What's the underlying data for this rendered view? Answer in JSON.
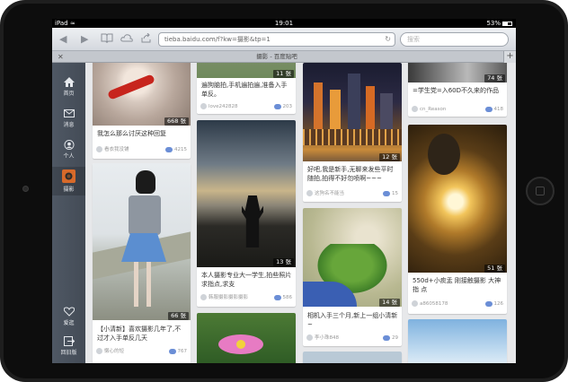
{
  "status": {
    "carrier": "iPad",
    "time": "19:01",
    "battery": "53%"
  },
  "browser": {
    "url": "tieba.baidu.com/f?kw=摄影&tp=1",
    "search_placeholder": "搜索",
    "tab_title": "摄影 - 百度贴吧",
    "tab_add": "+",
    "tab_close": "✕"
  },
  "sidebar": {
    "items": [
      {
        "label": "首页",
        "icon": "home-icon"
      },
      {
        "label": "消息",
        "icon": "mail-icon"
      },
      {
        "label": "个人",
        "icon": "person-icon"
      },
      {
        "label": "摄影",
        "icon": "forum-avatar"
      },
      {
        "label": "爱逛",
        "icon": "heart-icon"
      },
      {
        "label": "回旧版",
        "icon": "exit-icon"
      }
    ]
  },
  "posts": [
    {
      "count": "668 张",
      "caption": "我怎么那么讨厌这种回复",
      "user": "看衣我没铺",
      "replies": "4215"
    },
    {
      "count": "66 张",
      "caption": "【小清新】喜欢摄影几年了,不过才入手单反几天",
      "user": "懒心的短",
      "replies": "767"
    },
    {
      "count": "11 张",
      "caption": "遍狗脑拍,手机遍拍遍,准备入手单反。",
      "user": "love242828",
      "replies": "203"
    },
    {
      "count": "13 张",
      "caption": "本人摄影专业大一学生,拍些照片求指点,求支",
      "user": "韩服摄影摄影摄影",
      "replies": "586"
    },
    {
      "count": "12 张",
      "caption": "好吧,我是新手,无聊来发些平时随拍,拍得不好勿喷啊~~~",
      "user": "这狗名不能当",
      "replies": "15"
    },
    {
      "count": "14 张",
      "caption": "相机入手三个月,新上一组小清新~",
      "user": "李小珠848",
      "replies": "29"
    },
    {
      "count": "74 张",
      "caption": "=学生党=入60D不久来的作品",
      "user": "cn_Reason",
      "replies": "418"
    },
    {
      "count": "51 张",
      "caption": "550d+小痰盂 刚接触摄影 大神指 点",
      "user": "a86058178",
      "replies": "126"
    }
  ],
  "colors": {
    "sidebar": "#4a525d",
    "reply_icon": "#6b8ed6",
    "background": "#e7e8ea"
  }
}
